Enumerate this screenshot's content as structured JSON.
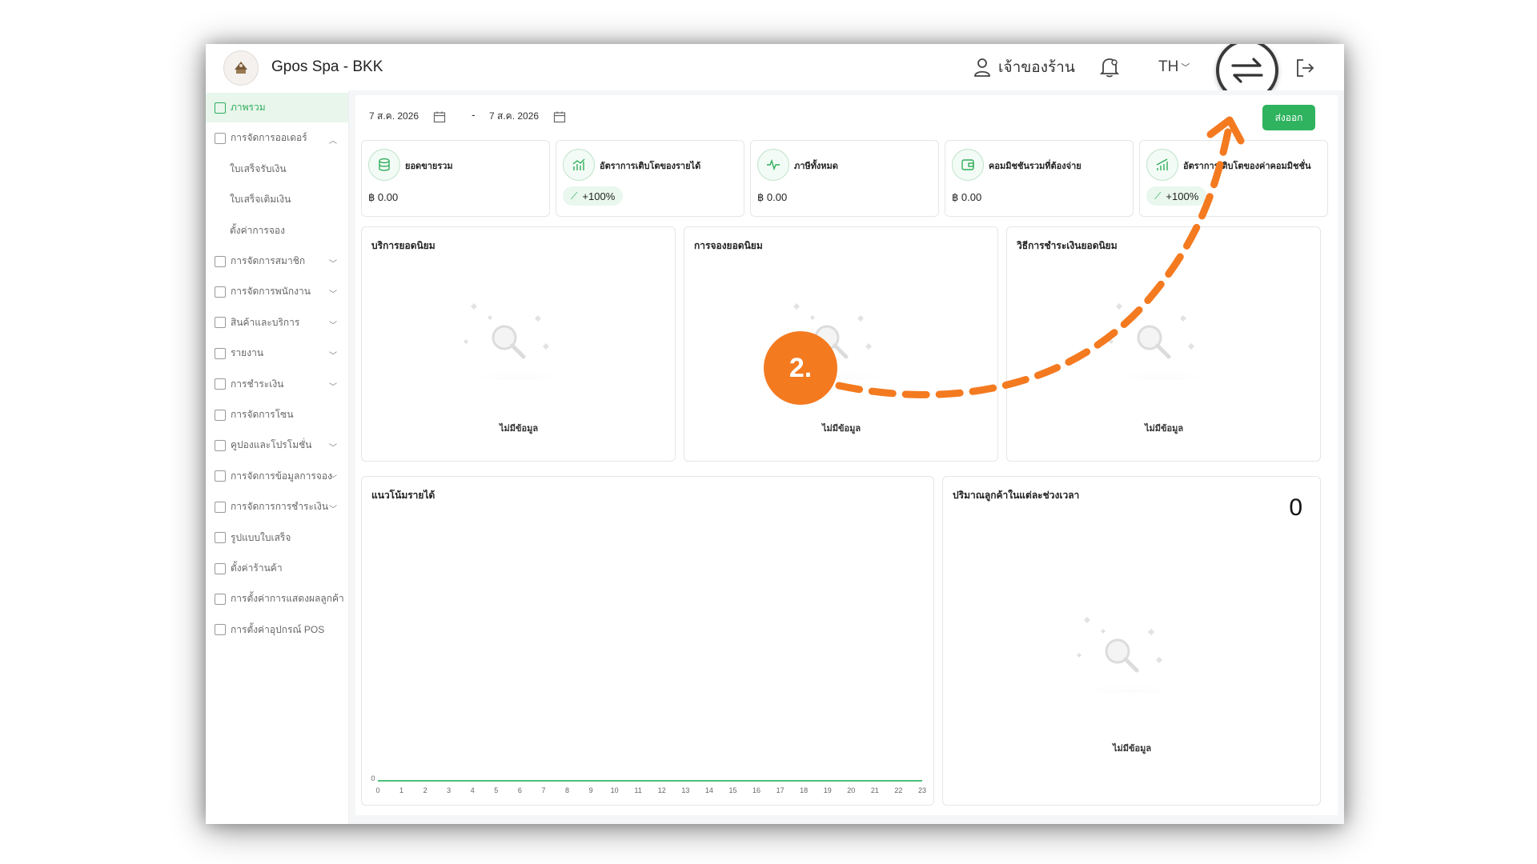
{
  "header": {
    "store_name": "Gpos Spa - BKK",
    "owner_label": "เจ้าของร้าน",
    "language": "TH",
    "icons": [
      "store-logo-icon",
      "user-icon",
      "bell-icon",
      "switch-arrows-icon",
      "logout-icon"
    ]
  },
  "sidebar": {
    "items": [
      {
        "label": "ภาพรวม",
        "active": true,
        "chevron": ""
      },
      {
        "label": "การจัดการออเดอร์",
        "chevron": "︿"
      },
      {
        "label": "ใบเสร็จรับเงิน",
        "sub": true
      },
      {
        "label": "ใบเสร็จเติมเงิน",
        "sub": true
      },
      {
        "label": "ตั้งค่าการจอง",
        "sub": true
      },
      {
        "label": "การจัดการสมาชิก",
        "chevron": "﹀"
      },
      {
        "label": "การจัดการพนักงาน",
        "chevron": "﹀"
      },
      {
        "label": "สินค้าและบริการ",
        "chevron": "﹀"
      },
      {
        "label": "รายงาน",
        "chevron": "﹀"
      },
      {
        "label": "การชำระเงิน",
        "chevron": "﹀"
      },
      {
        "label": "การจัดการโซน",
        "chevron": ""
      },
      {
        "label": "คูปองและโปรโมชั่น",
        "chevron": "﹀"
      },
      {
        "label": "การจัดการข้อมูลการจอง",
        "chevron": "﹀"
      },
      {
        "label": "การจัดการการชำระเงิน",
        "chevron": "﹀"
      },
      {
        "label": "รูปแบบใบเสร็จ",
        "chevron": ""
      },
      {
        "label": "ตั้งค่าร้านค้า",
        "chevron": ""
      },
      {
        "label": "การตั้งค่าการแสดงผลลูกค้า",
        "chevron": ""
      },
      {
        "label": "การตั้งค่าอุปกรณ์ POS",
        "chevron": ""
      }
    ]
  },
  "filters": {
    "start_date": "7 ส.ค. 2026",
    "end_date": "7 ส.ค. 2026",
    "separator": "-",
    "export_label": "ส่งออก"
  },
  "stats": [
    {
      "label": "ยอดขายรวม",
      "value": "฿ 0.00",
      "icon": "database-icon"
    },
    {
      "label": "อัตราการเติบโตของรายได้",
      "growth": "+100%",
      "icon": "bar-growth-icon"
    },
    {
      "label": "ภาษีทั้งหมด",
      "value": "฿ 0.00",
      "icon": "pulse-icon"
    },
    {
      "label": "คอมมิชชันรวมที่ต้องจ่าย",
      "value": "฿ 0.00",
      "icon": "wallet-icon"
    },
    {
      "label": "อัตราการเติบโตของค่าคอมมิชชั่น",
      "growth": "+100%",
      "icon": "signal-growth-icon"
    }
  ],
  "cards": {
    "popular_services": "บริการยอดนิยม",
    "popular_bookings": "การจองยอดนิยม",
    "popular_payments": "วิธีการชำระเงินยอดนิยม",
    "revenue_trend": "แนวโน้มรายได้",
    "customers_by_time": "ปริมาณลูกค้าในแต่ละช่วงเวลา",
    "customers_total": "0",
    "no_data": "ไม่มีข้อมูล"
  },
  "chart_data": {
    "type": "line",
    "x": [
      "0",
      "1",
      "2",
      "3",
      "4",
      "5",
      "6",
      "7",
      "8",
      "9",
      "10",
      "11",
      "12",
      "13",
      "14",
      "15",
      "16",
      "17",
      "18",
      "19",
      "20",
      "21",
      "22",
      "23"
    ],
    "series": [
      {
        "values": [
          0,
          0,
          0,
          0,
          0,
          0,
          0,
          0,
          0,
          0,
          0,
          0,
          0,
          0,
          0,
          0,
          0,
          0,
          0,
          0,
          0,
          0,
          0,
          0
        ]
      }
    ],
    "y_ticks": [
      "0"
    ],
    "color": "#4cc07a"
  },
  "annotation": {
    "step_label": "2.",
    "color": "#f47a20"
  },
  "colors": {
    "accent": "#2fb35f",
    "active_bg": "#e8f6ec",
    "annotation": "#f47a20"
  }
}
